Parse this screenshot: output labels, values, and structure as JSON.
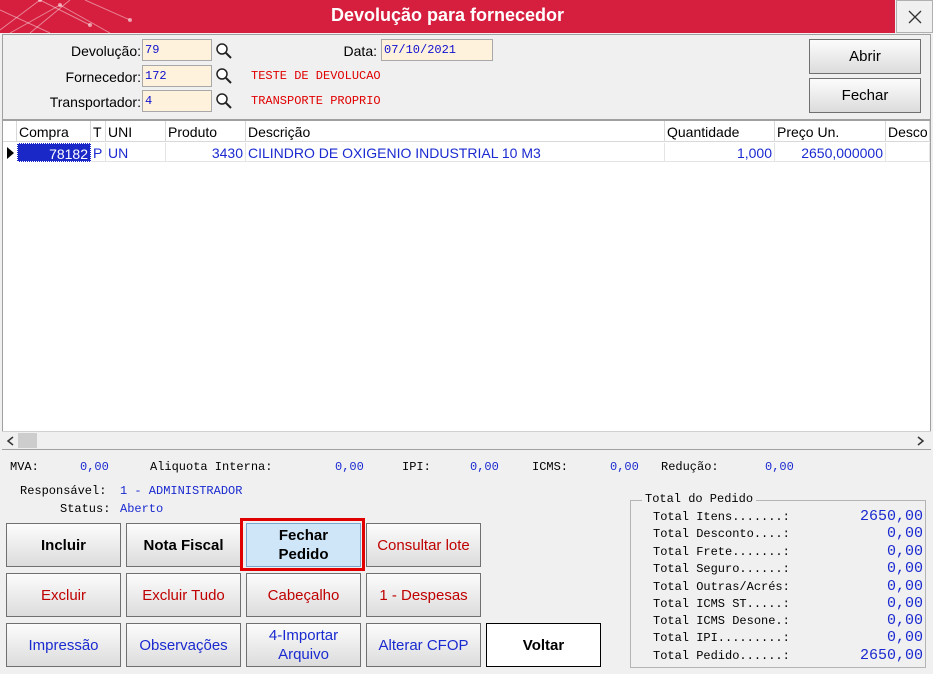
{
  "window": {
    "title": "Devolução para fornecedor"
  },
  "header": {
    "devolucao": {
      "label": "Devolução:",
      "value": "79"
    },
    "data": {
      "label": "Data:",
      "value": "07/10/2021"
    },
    "fornecedor": {
      "label": "Fornecedor:",
      "value": "172",
      "name": "TESTE DE DEVOLUCAO"
    },
    "transportador": {
      "label": "Transportador:",
      "value": "4",
      "name": "TRANSPORTE PROPRIO"
    },
    "abrir": "Abrir",
    "fechar": "Fechar"
  },
  "grid": {
    "columns": [
      "Compra",
      "T",
      "UNI",
      "Produto",
      "Descrição",
      "Quantidade",
      "Preço Un.",
      "Desco"
    ],
    "rows": [
      [
        "78182",
        "P",
        "UN",
        "3430",
        "CILINDRO DE OXIGENIO INDUSTRIAL 10 M3",
        "1,000",
        "2650,000000",
        ""
      ]
    ]
  },
  "taxes": {
    "mva": {
      "label": "MVA:",
      "value": "0,00"
    },
    "aliq": {
      "label": "Aliquota Interna:",
      "value": "0,00"
    },
    "ipi": {
      "label": "IPI:",
      "value": "0,00"
    },
    "icms": {
      "label": "ICMS:",
      "value": "0,00"
    },
    "reducao": {
      "label": "Redução:",
      "value": "0,00"
    }
  },
  "info": {
    "responsavel": {
      "label": "Responsável:",
      "value": "1 - ADMINISTRADOR"
    },
    "status": {
      "label": "Status:",
      "value": "Aberto"
    }
  },
  "buttons": {
    "incluir": "Incluir",
    "nota_fiscal": "Nota Fiscal",
    "fechar_pedido_1": "Fechar",
    "fechar_pedido_2": "Pedido",
    "consultar_lote": "Consultar lote",
    "excluir": "Excluir",
    "excluir_tudo": "Excluir Tudo",
    "cabecalho": "Cabeçalho",
    "despesas": "1 - Despesas",
    "impressao": "Impressão",
    "observacoes": "Observações",
    "importar_1": "4-Importar",
    "importar_2": "Arquivo",
    "alterar_cfop": "Alterar CFOP",
    "voltar": "Voltar"
  },
  "totals": {
    "title": "Total do Pedido",
    "rows": [
      {
        "label": "Total Itens.......:",
        "value": "2650,00"
      },
      {
        "label": "Total Desconto....:",
        "value": "0,00"
      },
      {
        "label": "Total Frete.......:",
        "value": "0,00"
      },
      {
        "label": "Total Seguro......:",
        "value": "0,00"
      },
      {
        "label": "Total Outras/Acrés:",
        "value": "0,00"
      },
      {
        "label": "Total ICMS ST.....:",
        "value": "0,00"
      },
      {
        "label": "Total ICMS Desone.:",
        "value": "0,00"
      },
      {
        "label": "Total IPI.........:",
        "value": "0,00"
      },
      {
        "label": "Total Pedido......:",
        "value": "2650,00"
      }
    ]
  },
  "colors": {
    "titlebar": "#d61f3f",
    "field_bg": "#fff2dd",
    "value_blue": "#1a2ad0",
    "red_text": "#e00000"
  }
}
